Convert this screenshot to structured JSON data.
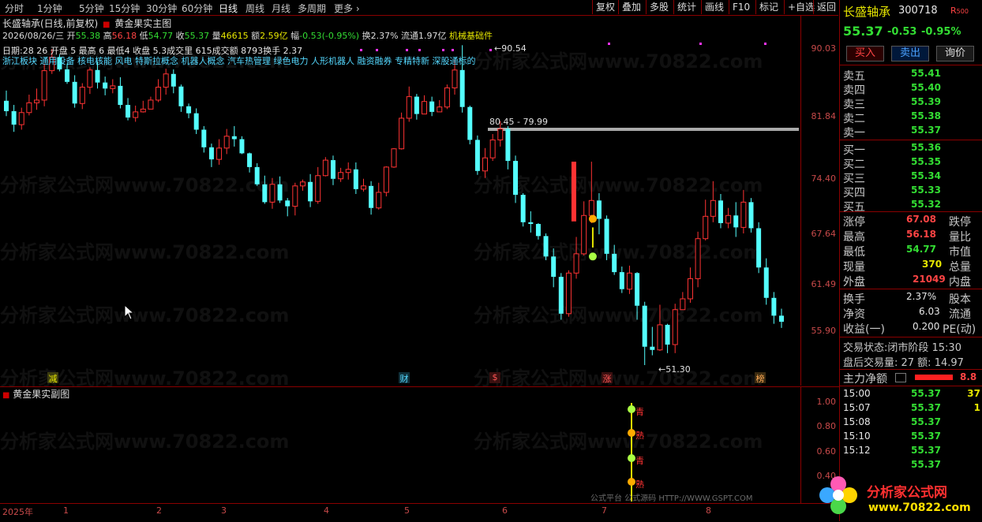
{
  "toolbar": {
    "periods": [
      "分时",
      "1分钟",
      "5分钟",
      "15分钟",
      "30分钟",
      "60分钟",
      "日线",
      "周线",
      "月线",
      "多周期",
      "更多 ›"
    ],
    "right_buttons": [
      "复权",
      "叠加",
      "多股",
      "统计",
      "画线",
      "F10",
      "标记",
      "+自选",
      "返回"
    ]
  },
  "header": {
    "title": "长盛轴承(日线,前复权)",
    "formula": "黄金果实主图",
    "date": "2026/08/26/三",
    "open_label": "开",
    "open": "55.38",
    "high_label": "高",
    "high": "56.18",
    "low_label": "低",
    "low": "54.77",
    "close_label": "收",
    "close": "55.37",
    "volume_label": "量",
    "volume": "46615",
    "amount_label": "额",
    "amount": "2.59亿",
    "change_label": "幅",
    "change": "-0.53(-0.95%)",
    "turnover_label": "换",
    "turnover": "2.37%",
    "float_label": "流通",
    "float": "1.97亿",
    "industry": "机械基础件"
  },
  "overlay_line": "日期:28 26 开盘 5 最高 6 最低4 收盘 5.3成交里 615成交额 8793换手 2.37",
  "concepts": "浙江板块 通用设备 核电核能 风电 特斯拉概念 机器人概念 汽车热管理 绿色电力 人形机器人 融资融券 专精特新 深股通标的",
  "price_axis": [
    "90.03",
    "81.84",
    "74.40",
    "67.64",
    "61.49",
    "55.90"
  ],
  "annotations": {
    "peak": "90.54",
    "range": "80.45 - 79.99",
    "low": "51.30"
  },
  "event_marks": [
    "减",
    "财",
    "$",
    "涨",
    "榜"
  ],
  "sub_chart": {
    "title": "黄金果实副图",
    "axis": [
      "1.00",
      "0.80",
      "0.60",
      "0.40"
    ],
    "marker_labels": [
      "青",
      "熟",
      "青",
      "熟"
    ]
  },
  "date_axis": [
    "2025年",
    "1",
    "2",
    "3",
    "4",
    "5",
    "6",
    "7",
    "8"
  ],
  "footer_note": "公式平台  公式源码 HTTP://WWW.GSPT.COM",
  "watermark": "分析家公式网www.70822.com",
  "right_panel": {
    "name": "长盛轴承",
    "code": "300718",
    "flag": "R",
    "flag_num": "500",
    "price": "55.37",
    "change": "-0.53",
    "change_pct": "-0.95%",
    "buttons": [
      "买入",
      "卖出",
      "询价"
    ],
    "sell": [
      {
        "label": "卖五",
        "price": "55.41"
      },
      {
        "label": "卖四",
        "price": "55.40"
      },
      {
        "label": "卖三",
        "price": "55.39"
      },
      {
        "label": "卖二",
        "price": "55.38"
      },
      {
        "label": "卖一",
        "price": "55.37"
      }
    ],
    "buy": [
      {
        "label": "买一",
        "price": "55.36"
      },
      {
        "label": "买二",
        "price": "55.35"
      },
      {
        "label": "买三",
        "price": "55.34"
      },
      {
        "label": "买四",
        "price": "55.33"
      },
      {
        "label": "买五",
        "price": "55.32"
      }
    ],
    "stats": [
      {
        "label": "涨停",
        "value": "67.08",
        "label2": "跌停"
      },
      {
        "label": "最高",
        "value": "56.18",
        "label2": "量比"
      },
      {
        "label": "最低",
        "value": "54.77",
        "label2": "市值"
      },
      {
        "label": "现量",
        "value": "370",
        "label2": "总量"
      },
      {
        "label": "外盘",
        "value": "21049",
        "label2": "内盘"
      }
    ],
    "stats2": [
      {
        "label": "换手",
        "value": "2.37%",
        "label2": "股本"
      },
      {
        "label": "净资",
        "value": "6.03",
        "label2": "流通"
      },
      {
        "label": "收益(一)",
        "value": "0.200",
        "label2": "PE(动)"
      }
    ],
    "trade_state": "交易状态:闭市阶段 15:30",
    "after_hours": "盘后交易量: 27  额: 14.97",
    "main_flow_label": "主力净额",
    "main_flow_value": "8.8",
    "ticks": [
      {
        "time": "15:00",
        "price": "55.37",
        "vol": "37"
      },
      {
        "time": "15:07",
        "price": "55.37",
        "vol": "1"
      },
      {
        "time": "15:08",
        "price": "55.37",
        "vol": ""
      },
      {
        "time": "15:10",
        "price": "55.37",
        "vol": ""
      },
      {
        "time": "15:12",
        "price": "55.37",
        "vol": ""
      },
      {
        "time": "",
        "price": "55.37",
        "vol": ""
      }
    ],
    "logo_text": "分析家公式网",
    "logo_url": "www.70822.com"
  },
  "colors": {
    "up": "#ff3333",
    "down": "#54ffff",
    "axis_red": "#c84a4a",
    "green_price": "#33dd33",
    "yellow": "#e6e600"
  },
  "chart_data": {
    "type": "candlestick",
    "ylim": [
      51.3,
      90.54
    ],
    "y_ticks": [
      55.9,
      61.49,
      67.64,
      74.4,
      81.84,
      90.03
    ],
    "candles": [
      [
        82.0,
        80.5,
        83.5,
        79.8
      ],
      [
        80.5,
        78.6,
        81.4,
        77.6
      ],
      [
        78.6,
        80.3,
        81.0,
        77.9
      ],
      [
        80.3,
        81.7,
        82.9,
        79.9
      ],
      [
        81.7,
        82.1,
        83.8,
        80.7
      ],
      [
        82.1,
        86.5,
        87.6,
        81.2
      ],
      [
        86.5,
        88.6,
        89.9,
        86.0
      ],
      [
        88.6,
        86.7,
        89.0,
        86.4
      ],
      [
        86.7,
        84.8,
        87.6,
        84.5
      ],
      [
        84.8,
        81.6,
        85.8,
        81.0
      ],
      [
        81.6,
        84.0,
        84.6,
        80.8
      ],
      [
        84.0,
        86.6,
        87.0,
        83.0
      ],
      [
        86.6,
        84.7,
        87.9,
        83.8
      ],
      [
        84.7,
        83.8,
        85.6,
        82.8
      ],
      [
        83.8,
        84.2,
        85.2,
        83.1
      ],
      [
        84.2,
        81.4,
        85.5,
        80.9
      ],
      [
        81.4,
        79.6,
        82.4,
        79.2
      ],
      [
        79.6,
        80.4,
        81.3,
        79.0
      ],
      [
        80.4,
        80.8,
        82.0,
        80.3
      ],
      [
        80.8,
        82.1,
        82.6,
        81.0
      ],
      [
        82.1,
        84.0,
        85.2,
        81.8
      ],
      [
        84.0,
        86.0,
        86.8,
        82.9
      ],
      [
        86.0,
        84.1,
        86.7,
        83.1
      ],
      [
        84.1,
        81.2,
        84.4,
        80.4
      ],
      [
        81.2,
        80.2,
        81.6,
        79.5
      ],
      [
        80.2,
        77.9,
        80.9,
        77.3
      ],
      [
        77.9,
        75.5,
        78.4,
        74.8
      ],
      [
        75.5,
        73.9,
        76.0,
        72.9
      ],
      [
        73.9,
        75.4,
        76.6,
        73.2
      ],
      [
        75.4,
        77.0,
        78.0,
        74.6
      ],
      [
        77.0,
        76.6,
        78.4,
        75.6
      ],
      [
        76.6,
        74.7,
        77.0,
        74.6
      ],
      [
        74.7,
        72.9,
        74.8,
        72.2
      ],
      [
        72.9,
        70.7,
        73.4,
        70.5
      ],
      [
        70.7,
        68.5,
        71.8,
        68.3
      ],
      [
        68.5,
        70.7,
        71.5,
        67.7
      ],
      [
        70.7,
        68.7,
        71.7,
        68.4
      ],
      [
        68.7,
        68.0,
        69.0,
        66.8
      ],
      [
        68.0,
        70.5,
        70.9,
        66.9
      ],
      [
        70.5,
        71.0,
        71.3,
        69.9
      ],
      [
        71.0,
        68.6,
        72.0,
        67.9
      ],
      [
        68.6,
        71.8,
        72.9,
        68.3
      ],
      [
        71.8,
        73.8,
        74.2,
        71.7
      ],
      [
        73.8,
        71.4,
        74.4,
        70.6
      ],
      [
        71.4,
        72.2,
        72.8,
        71.0
      ],
      [
        72.2,
        72.6,
        73.5,
        71.3
      ],
      [
        72.6,
        70.1,
        73.5,
        69.5
      ],
      [
        70.1,
        70.5,
        71.4,
        69.8
      ],
      [
        70.5,
        67.8,
        71.1,
        67.0
      ],
      [
        67.8,
        69.7,
        70.9,
        67.6
      ],
      [
        69.7,
        72.9,
        73.0,
        69.2
      ],
      [
        72.9,
        75.3,
        75.4,
        72.8
      ],
      [
        75.3,
        79.5,
        80.3,
        75.2
      ],
      [
        79.5,
        82.6,
        84.1,
        79.0
      ],
      [
        82.6,
        80.1,
        83.0,
        79.3
      ],
      [
        80.1,
        81.9,
        82.8,
        80.1
      ],
      [
        81.9,
        80.4,
        82.6,
        79.8
      ],
      [
        80.4,
        81.1,
        82.1,
        80.4
      ],
      [
        81.1,
        83.9,
        84.4,
        80.8
      ],
      [
        83.9,
        86.6,
        88.2,
        82.9
      ],
      [
        86.6,
        81.1,
        90.5,
        80.3
      ],
      [
        81.1,
        76.5,
        81.3,
        75.9
      ],
      [
        76.5,
        72.4,
        77.1,
        71.9
      ],
      [
        72.4,
        74.1,
        75.4,
        71.5
      ],
      [
        74.1,
        76.5,
        77.3,
        73.7
      ],
      [
        76.5,
        78.0,
        79.1,
        75.6
      ],
      [
        78.0,
        73.7,
        78.4,
        72.6
      ],
      [
        73.7,
        69.4,
        74.4,
        68.4
      ],
      [
        69.4,
        66.1,
        69.6,
        65.6
      ],
      [
        66.1,
        65.9,
        67.4,
        64.9
      ],
      [
        65.9,
        64.5,
        66.0,
        64.1
      ],
      [
        64.5,
        62.2,
        64.8,
        61.8
      ],
      [
        62.2,
        60.0,
        63.1,
        58.9
      ],
      [
        60.0,
        56.2,
        60.4,
        55.6
      ],
      [
        56.2,
        60.4,
        60.7,
        55.9
      ],
      [
        60.4,
        62.5,
        64.4,
        59.8
      ],
      [
        62.5,
        66.9,
        68.6,
        62.3
      ],
      [
        66.9,
        68.7,
        73.6,
        66.0
      ],
      [
        68.7,
        66.5,
        69.6,
        64.7
      ],
      [
        66.5,
        62.5,
        66.9,
        61.8
      ],
      [
        62.5,
        60.5,
        63.5,
        60.2
      ],
      [
        60.5,
        58.7,
        61.1,
        58.3
      ],
      [
        58.7,
        60.4,
        61.2,
        58.2
      ],
      [
        60.4,
        57.0,
        60.5,
        55.6
      ],
      [
        57.0,
        53.0,
        57.4,
        51.3
      ],
      [
        53.0,
        52.7,
        54.9,
        52.2
      ],
      [
        52.7,
        55.1,
        57.1,
        52.6
      ],
      [
        55.1,
        53.2,
        55.2,
        52.4
      ],
      [
        53.2,
        56.6,
        57.2,
        52.4
      ],
      [
        56.6,
        57.7,
        58.4,
        56.6
      ],
      [
        57.7,
        59.8,
        61.0,
        57.3
      ],
      [
        59.8,
        64.2,
        65.0,
        58.9
      ],
      [
        64.2,
        66.8,
        68.8,
        64.0
      ],
      [
        66.8,
        68.7,
        71.1,
        66.1
      ],
      [
        68.7,
        66.0,
        69.5,
        65.4
      ],
      [
        66.0,
        66.9,
        67.8,
        65.4
      ],
      [
        66.9,
        65.5,
        68.5,
        64.4
      ],
      [
        65.5,
        68.5,
        70.0,
        64.8
      ],
      [
        68.5,
        65.4,
        69.0,
        64.9
      ],
      [
        65.4,
        61.0,
        66.1,
        60.4
      ],
      [
        61.0,
        57.8,
        62.0,
        57.1
      ],
      [
        57.8,
        56.0,
        58.4,
        55.2
      ],
      [
        56.0,
        55.4,
        56.7,
        54.8
      ]
    ],
    "sub_series": [
      0,
      0,
      0,
      0,
      0,
      0,
      0,
      0,
      0,
      0,
      0,
      0,
      0,
      0,
      0,
      0,
      0,
      0,
      0,
      0,
      0,
      0,
      0,
      0,
      0,
      0,
      0,
      0,
      0,
      0,
      0,
      0,
      0,
      0,
      0,
      0,
      0,
      0,
      0,
      0,
      0,
      0,
      0,
      0,
      0,
      0,
      0,
      0,
      0,
      0,
      0,
      0,
      0,
      0,
      0,
      0,
      0,
      0,
      0,
      0,
      0,
      0,
      0,
      0,
      0,
      0,
      0,
      0,
      0,
      0,
      0,
      0,
      0,
      0,
      0,
      0,
      0,
      0,
      1,
      0,
      0,
      0,
      0,
      0,
      0,
      0,
      0,
      0,
      0,
      0,
      0,
      0,
      0,
      0,
      0,
      0,
      0,
      0,
      0,
      0,
      0,
      0,
      0,
      0
    ]
  }
}
